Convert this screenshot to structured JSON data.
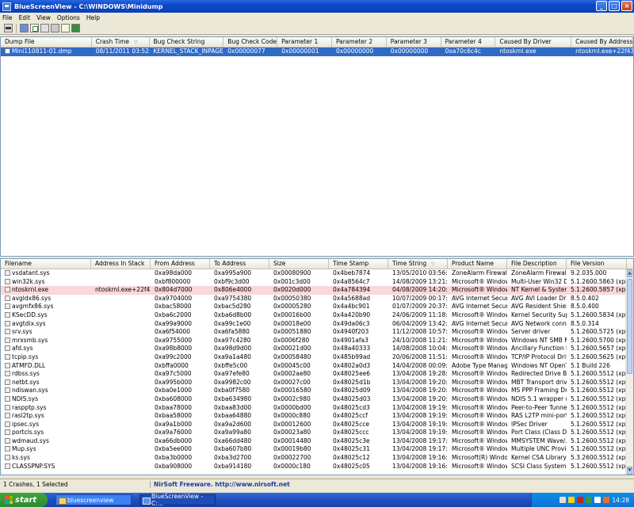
{
  "window": {
    "title": "BlueScreenView  -  C:\\WINDOWS\\Minidump"
  },
  "menu": [
    "File",
    "Edit",
    "View",
    "Options",
    "Help"
  ],
  "upper": {
    "columns": [
      "Dump File",
      "Crash Time",
      "Bug Check String",
      "Bug Check Code",
      "Parameter 1",
      "Parameter 2",
      "Parameter 3",
      "Parameter 4",
      "Caused By Driver",
      "Caused By Address"
    ],
    "rows": [
      [
        "Mini110811-01.dmp",
        "08/11/2011 03:52:08",
        "KERNEL_STACK_INPAGE_...",
        "0x00000077",
        "0x00000001",
        "0x00000000",
        "0x00000000",
        "0xa70c6c4c",
        "ntoskrnl.exe",
        "ntoskrnl.exe+22f43"
      ]
    ]
  },
  "lower": {
    "columns": [
      "Filename",
      "Address In Stack",
      "From Address",
      "To Address",
      "Size",
      "Time Stamp",
      "Time String",
      "Product Name",
      "File Description",
      "File Version"
    ],
    "rows": [
      [
        "vsdatant.sys",
        "",
        "0xa98da000",
        "0xa995a900",
        "0x00080900",
        "0x4beb7874",
        "13/05/2010 03:56:36",
        "ZoneAlarm Firewalli...",
        "ZoneAlarm Firewalli...",
        "9.2.035.000"
      ],
      [
        "win32k.sys",
        "",
        "0xbf800000",
        "0xbf9c3d00",
        "0x001c3d00",
        "0x4a8564c7",
        "14/08/2009 13:21:11",
        "Microsoft® Window...",
        "Multi-User Win32 Dr...",
        "5.1.2600.5863 (xps..."
      ],
      [
        "ntoskrnl.exe",
        "ntoskrnl.exe+22f43",
        "0x804d7000",
        "0x806e4000",
        "0x0020d000",
        "0x4a784394",
        "04/08/2009 14:20:04",
        "Microsoft® Window...",
        "NT Kernel & System",
        "5.1.2600.5857 (xps..."
      ],
      [
        "avgldx86.sys",
        "",
        "0xa9704000",
        "0xa9754380",
        "0x00050380",
        "0x4a5688ad",
        "10/07/2009 00:17:49",
        "AVG Internet Security",
        "AVG AVI Loader Driver",
        "8.5.0.402"
      ],
      [
        "avgmfx86.sys",
        "",
        "0xbac58000",
        "0xbac5d280",
        "0x00005280",
        "0x4a4bc901",
        "01/07/2009 20:37:21",
        "AVG Internet Security",
        "AVG Resident Shield...",
        "8.5.0.400"
      ],
      [
        "KSecDD.sys",
        "",
        "0xba6c2000",
        "0xba6d8b00",
        "0x00016b00",
        "0x4a420b90",
        "24/06/2009 11:18:40",
        "Microsoft® Window...",
        "Kernel Security Sup...",
        "5.1.2600.5834 (xps..."
      ],
      [
        "avgtdix.sys",
        "",
        "0xa99a9000",
        "0xa99c1e00",
        "0x00018e00",
        "0x49da06c3",
        "06/04/2009 13:42:27",
        "AVG Internet Security",
        "AVG Network conne...",
        "8.5.0.314"
      ],
      [
        "srv.sys",
        "",
        "0xa6f54000",
        "0xa6fa5880",
        "0x00051880",
        "0x4940f203",
        "11/12/2008 10:57:07",
        "Microsoft® Window...",
        "Server driver",
        "5.1.2600.5725 (xps..."
      ],
      [
        "mrxsmb.sys",
        "",
        "0xa9755000",
        "0xa97c4280",
        "0x0006f280",
        "0x4901afa3",
        "24/10/2008 11:21:07",
        "Microsoft® Window...",
        "Windows NT SMB Mi...",
        "5.1.2600.5700 (xps..."
      ],
      [
        "afd.sys",
        "",
        "0xa98b8000",
        "0xa98d9d00",
        "0x00021d00",
        "0x48a40333",
        "14/08/2008 10:04:35",
        "Microsoft® Window...",
        "Ancillary Function D...",
        "5.1.2600.5657 (xps..."
      ],
      [
        "tcpip.sys",
        "",
        "0xa99c2000",
        "0xa9a1a480",
        "0x00058480",
        "0x485b99ad",
        "20/06/2008 11:51:09",
        "Microsoft® Window...",
        "TCP/IP Protocol Driver",
        "5.1.2600.5625 (xps..."
      ],
      [
        "ATMFD.DLL",
        "",
        "0xbffa0000",
        "0xbffe5c00",
        "0x00045c00",
        "0x4802a0d3",
        "14/04/2008 00:09:55",
        "Adobe Type Manager",
        "Windows NT OpenT...",
        "5.1 Build 226"
      ],
      [
        "rdbss.sys",
        "",
        "0xa97c5000",
        "0xa97efe80",
        "0x0002ae80",
        "0x48025ee6",
        "13/04/2008 19:28:38",
        "Microsoft® Window...",
        "Redirected Drive Bu...",
        "5.1.2600.5512 (xps..."
      ],
      [
        "netbt.sys",
        "",
        "0xa995b000",
        "0xa9982c00",
        "0x00027c00",
        "0x48025d1b",
        "13/04/2008 19:20:59",
        "Microsoft® Window...",
        "MBT Transport driver",
        "5.1.2600.5512 (xps..."
      ],
      [
        "ndiswan.sys",
        "",
        "0xba0e1000",
        "0xba0f7580",
        "0x00016580",
        "0x48025d09",
        "13/04/2008 19:20:41",
        "Microsoft® Window...",
        "MS PPP Framing Dri...",
        "5.1.2600.5512 (xps..."
      ],
      [
        "NDIS.sys",
        "",
        "0xba608000",
        "0xba634980",
        "0x0002c980",
        "0x48025d03",
        "13/04/2008 19:20:35",
        "Microsoft® Window...",
        "NDIS 5.1 wrapper d...",
        "5.1.2600.5512 (xps..."
      ],
      [
        "raspptp.sys",
        "",
        "0xbaa78000",
        "0xbaa83d00",
        "0x0000bd00",
        "0x48025cd3",
        "13/04/2008 19:19:47",
        "Microsoft® Window...",
        "Peer-to-Peer Tunne...",
        "5.1.2600.5512 (xps..."
      ],
      [
        "rasl2tp.sys",
        "",
        "0xbaa58000",
        "0xbaa64880",
        "0x0000c880",
        "0x48025ccf",
        "13/04/2008 19:19:43",
        "Microsoft® Window...",
        "RAS L2TP mini-port/...",
        "5.1.2600.5512 (xps..."
      ],
      [
        "ipsec.sys",
        "",
        "0xa9a1b000",
        "0xa9a2d600",
        "0x00012600",
        "0x48025cce",
        "13/04/2008 19:19:42",
        "Microsoft® Window...",
        "IPSec Driver",
        "5.1.2600.5512 (xps..."
      ],
      [
        "portcls.sys",
        "",
        "0xa9a76000",
        "0xa9a99a80",
        "0x00023a80",
        "0x48025ccc",
        "13/04/2008 19:19:40",
        "Microsoft® Window...",
        "Port Class (Class Dri...",
        "5.1.2600.5512 (xps..."
      ],
      [
        "wdmaud.sys",
        "",
        "0xa66db000",
        "0xa66dd480",
        "0x00014480",
        "0x48025c3e",
        "13/04/2008 19:17:18",
        "Microsoft® Window...",
        "MMSYSTEM Wave/...",
        "5.1.2600.5512 (xps..."
      ],
      [
        "Mup.sys",
        "",
        "0xba5ee000",
        "0xba607b80",
        "0x00019b80",
        "0x48025c31",
        "13/04/2008 19:17:05",
        "Microsoft® Window...",
        "Multiple UNC Provid...",
        "5.1.2600.5512 (xps..."
      ],
      [
        "ks.sys",
        "",
        "0xba3b0000",
        "0xba3d2700",
        "0x00022700",
        "0x48025c12",
        "13/04/2008 19:16:34",
        "Microsoft(R) Window...",
        "Kernel CSA Library",
        "5.3.2600.5512 (xps..."
      ],
      [
        "CLASSPNP.SYS",
        "",
        "0xba908000",
        "0xba914180",
        "0x0000c180",
        "0x48025c05",
        "13/04/2008 19:16:21",
        "Microsoft® Window...",
        "SCSI Class System Dll",
        "5.1.2600.5512 (xps..."
      ]
    ]
  },
  "status": {
    "left": "1 Crashes, 1 Selected",
    "right": "NirSoft Freeware.  http://www.nirsoft.net"
  },
  "taskbar": {
    "start": "start",
    "tasks": [
      "bluescreenview",
      "BlueScreenView - C:..."
    ],
    "clock": "14:28"
  }
}
